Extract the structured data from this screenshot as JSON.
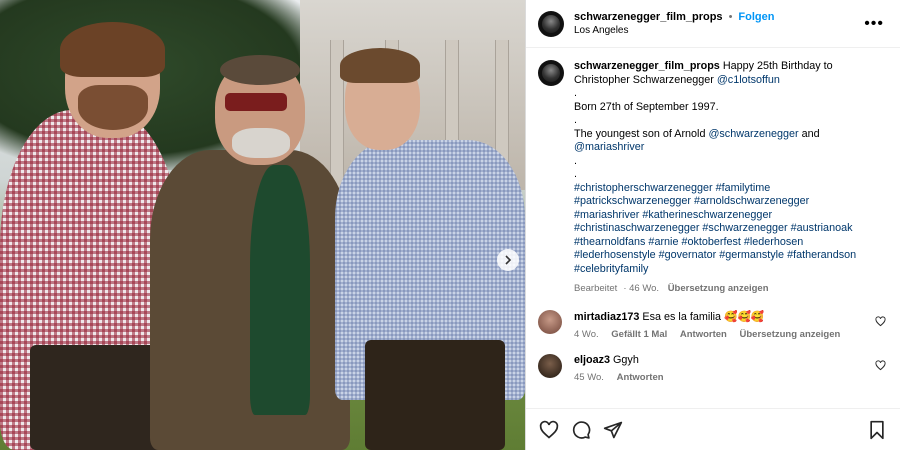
{
  "post": {
    "username": "schwarzenegger_film_props",
    "separator": "•",
    "follow_label": "Folgen",
    "location": "Los Angeles",
    "more_label": "•••"
  },
  "caption": {
    "username": "schwarzenegger_film_props",
    "line1": "Happy 25th Birthday to",
    "line2": "Christopher Schwarzenegger",
    "mention1": "@c1lotsoffun",
    "dot1": ".",
    "born": "Born 27th of September 1997.",
    "dot2": ".",
    "youngest": "The youngest son of Arnold",
    "mention2": "@schwarzenegger",
    "and": "and",
    "mention3": "@mariashriver",
    "dot3": ".",
    "dot4": ".",
    "tags": [
      "#christopherschwarzenegger #familytime",
      "#patrickschwarzenegger #arnoldschwarzenegger",
      "#mariashriver #katherineschwarzenegger",
      "#christinaschwarzenegger #schwarzenegger #austrianoak",
      "#thearnoldfans #arnie #oktoberfest #lederhosen",
      "#lederhosenstyle #governator #germanstyle #fatherandson",
      "#celebrityfamily"
    ],
    "edited": "Bearbeitet",
    "time": "· 46 Wo.",
    "translate": "Übersetzung anzeigen"
  },
  "comments": [
    {
      "username": "mirtadiaz173",
      "text": "Esa es la familia 🥰🥰🥰",
      "time": "4 Wo.",
      "likes": "Gefällt 1 Mal",
      "reply": "Antworten",
      "translate": "Übersetzung anzeigen"
    },
    {
      "username": "eljoaz3",
      "text": "Ggyh",
      "time": "45 Wo.",
      "reply": "Antworten"
    }
  ],
  "icons": {
    "like": "heart-icon",
    "comment": "comment-icon",
    "share": "share-icon",
    "save": "bookmark-icon",
    "next": "chevron-right-icon",
    "more": "more-icon"
  },
  "colors": {
    "follow": "#0095f6",
    "link": "#00376b",
    "meta": "#737373"
  }
}
